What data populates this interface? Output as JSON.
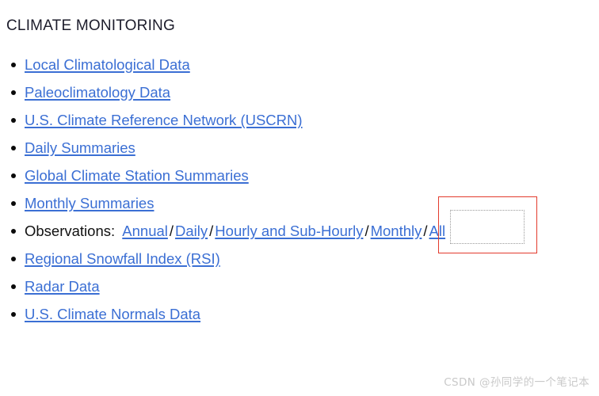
{
  "page": {
    "heading": "CLIMATE MONITORING",
    "background_color": "#ffffff",
    "link_color": "#3b6fd4",
    "text_color": "#111111",
    "heading_color": "#1c1c2b"
  },
  "list": {
    "items": [
      {
        "type": "link",
        "label": "Local Climatological Data"
      },
      {
        "type": "link",
        "label": "Paleoclimatology Data"
      },
      {
        "type": "link",
        "label": "U.S. Climate Reference Network (USCRN)"
      },
      {
        "type": "link",
        "label": "Daily Summaries"
      },
      {
        "type": "link",
        "label": "Global Climate Station Summaries"
      },
      {
        "type": "link",
        "label": "Monthly Summaries"
      },
      {
        "type": "composite",
        "label": "Observations:",
        "links": [
          "Annual",
          "Daily",
          "Hourly and Sub-Hourly",
          "Monthly",
          "All"
        ],
        "separator": "/"
      },
      {
        "type": "link",
        "label": "Regional Snowfall Index (RSI)"
      },
      {
        "type": "link",
        "label": "Radar Data"
      },
      {
        "type": "link",
        "label": "U.S. Climate Normals Data"
      }
    ]
  },
  "annotation": {
    "red_box": {
      "color": "#e33b2d",
      "target": "Monthly",
      "style": "solid"
    },
    "dotted_box": {
      "color": "#9a9a9a",
      "target": "Monthly",
      "style": "dotted"
    }
  },
  "watermark": {
    "text": "CSDN @孙同学的一个笔记本",
    "color": "#c9c9c9"
  }
}
